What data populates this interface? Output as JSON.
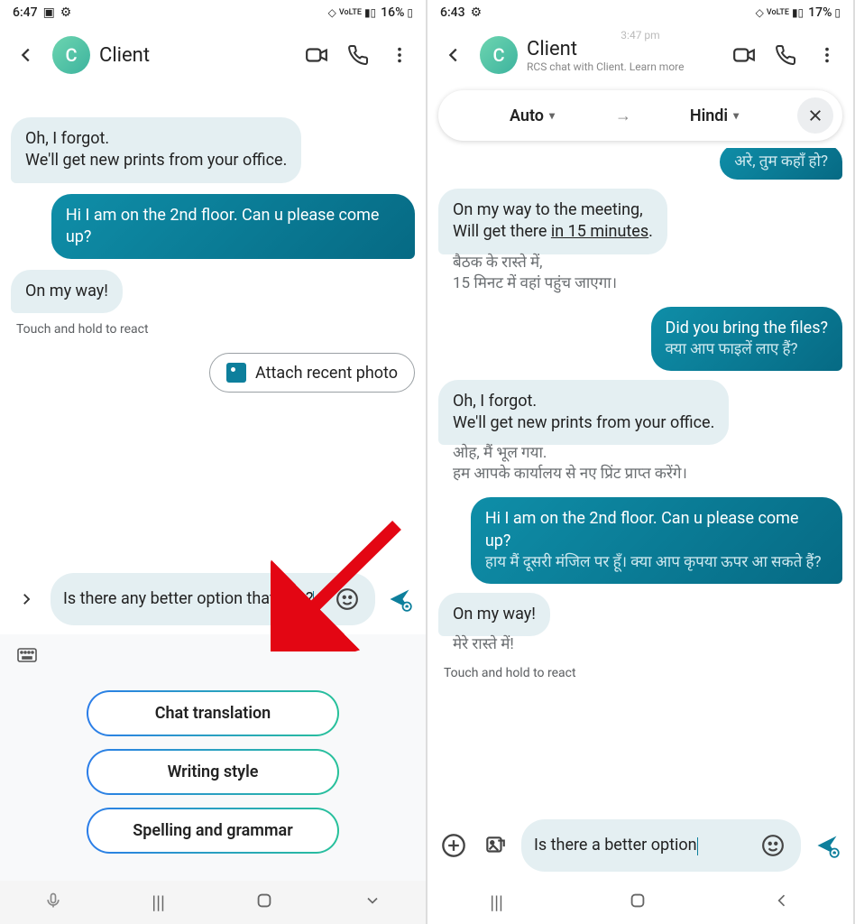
{
  "left": {
    "status": {
      "time": "6:47",
      "battery": "16%"
    },
    "header": {
      "avatar": "C",
      "title": "Client"
    },
    "msgs": {
      "m1a": "Oh, I forgot.",
      "m1b": "We'll get new prints from your office.",
      "m2": "Hi I am on the 2nd floor. Can u please come up?",
      "m3": "On my way!",
      "react": "Touch and hold to react",
      "attach": "Attach recent photo",
      "compose": "Is there any better option that this?"
    },
    "ai": {
      "b1": "Chat translation",
      "b2": "Writing style",
      "b3": "Spelling and grammar"
    }
  },
  "right": {
    "status": {
      "time": "6:43",
      "battery": "17%"
    },
    "header": {
      "avatar": "C",
      "title": "Client",
      "sub": "RCS chat with Client. Learn more"
    },
    "ts": "3:47 pm",
    "trans": {
      "from": "Auto",
      "to": "Hindi"
    },
    "msgs": {
      "m0t": "अरे, तुम कहाँ हो?",
      "m1a": "On my way to the meeting,",
      "m1b_pre": "Will get there ",
      "m1b_link": "in 15 minutes",
      "m1b_suf": ".",
      "m1t1": "बैठक के रास्ते में,",
      "m1t2": "15 मिनट में वहां पहुंच जाएगा।",
      "m2": "Did you bring the files?",
      "m2t": "क्या आप फाइलें लाए हैं?",
      "m3a": "Oh, I forgot.",
      "m3b": "We'll get new prints from your office.",
      "m3t1": "ओह, मैं भूल गया.",
      "m3t2": "हम आपके कार्यालय से नए प्रिंट प्राप्त करेंगे।",
      "m4": "Hi I am on the 2nd floor. Can u please come up?",
      "m4t": "हाय मैं दूसरी मंजिल पर हूँ। क्या आप कृपया ऊपर आ सकते हैं?",
      "m5": "On my way!",
      "m5t": "मेरे रास्ते में!",
      "react": "Touch and hold to react",
      "compose": "Is there a better option"
    }
  }
}
